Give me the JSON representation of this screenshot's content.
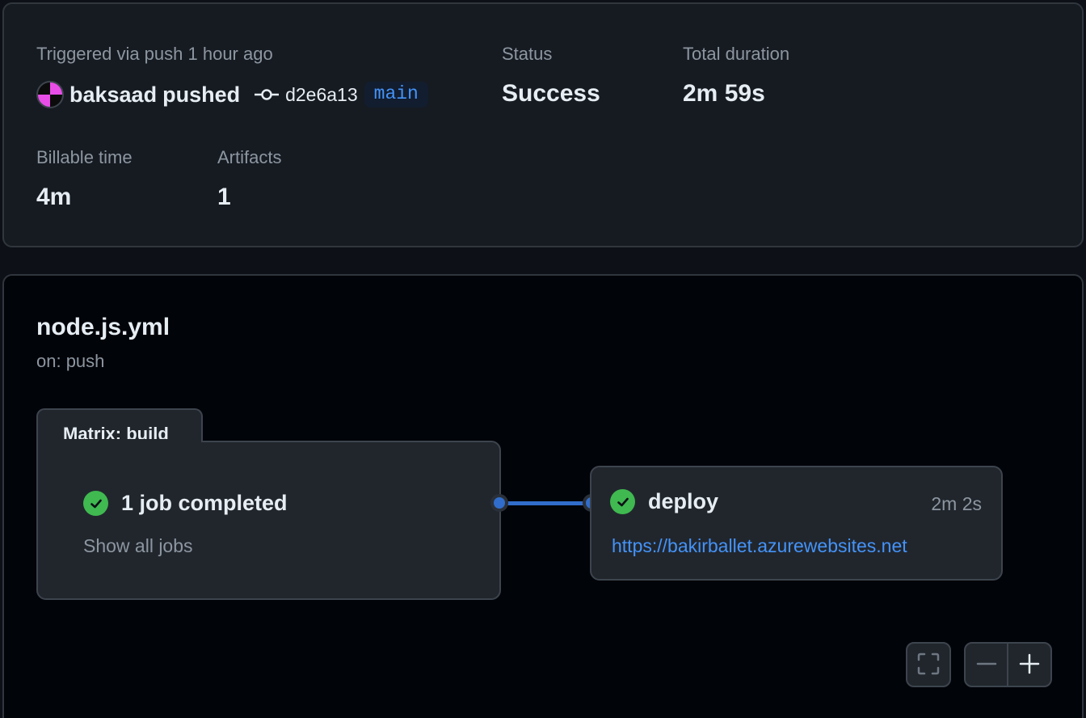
{
  "summary": {
    "trigger_text": "Triggered via push 1 hour ago",
    "actor": "baksaad",
    "action": "pushed",
    "commit_sha": "d2e6a13",
    "branch": "main",
    "status_label": "Status",
    "status_value": "Success",
    "duration_label": "Total duration",
    "duration_value": "2m 59s",
    "billable_label": "Billable time",
    "billable_value": "4m",
    "artifacts_label": "Artifacts",
    "artifacts_value": "1"
  },
  "workflow": {
    "name": "node.js.yml",
    "trigger": "on: push",
    "matrix": {
      "title": "Matrix: build",
      "status_text": "1 job completed",
      "show_jobs_label": "Show all jobs"
    },
    "deploy": {
      "name": "deploy",
      "duration": "2m 2s",
      "url": "https://bakirballet.azurewebsites.net"
    }
  },
  "controls": {
    "fullscreen_icon": "fullscreen-icon",
    "zoom_out_icon": "minus-icon",
    "zoom_in_icon": "plus-icon"
  },
  "colors": {
    "success": "#3fb950",
    "link": "#4493f8",
    "connector": "#316dca",
    "avatar": "#e84de8"
  }
}
